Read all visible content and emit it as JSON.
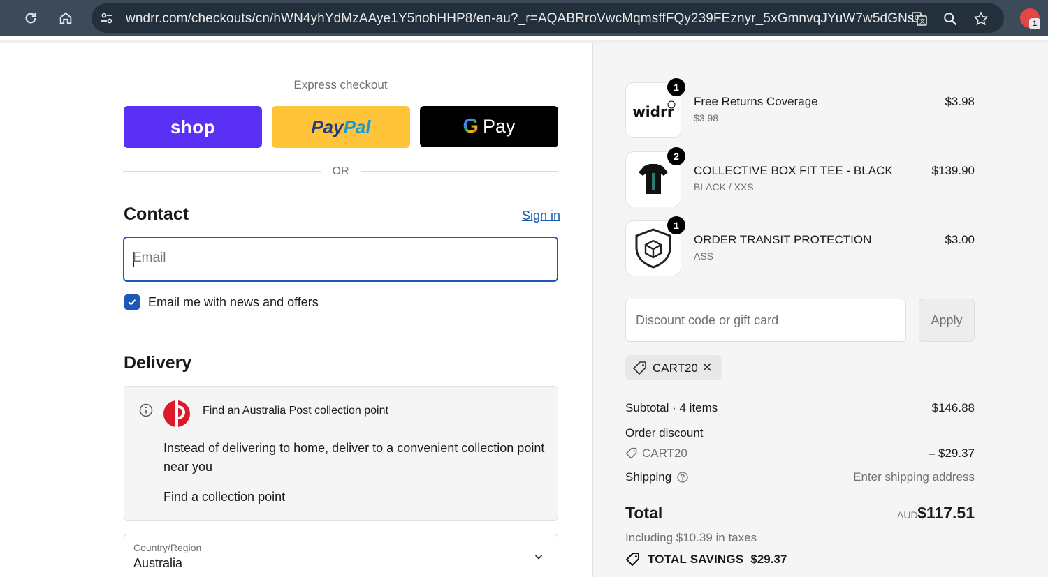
{
  "browser": {
    "url": "wndrr.com/checkouts/cn/hWN4yhYdMzAAye1Y5nohHHP8/en-au?_r=AQABRroVwcMqmsffFQy239FEznyr_5xGmnvqJYuW7w5dGNs",
    "profile_badge": "1"
  },
  "express": {
    "title": "Express checkout",
    "shop_label": "shop",
    "paypal_part1": "Pay",
    "paypal_part2": "Pal",
    "gpay_g": "G",
    "gpay_label": "Pay",
    "or_text": "OR"
  },
  "contact": {
    "title": "Contact",
    "sign_in": "Sign in",
    "email_placeholder": "Email",
    "news_label": "Email me with news and offers",
    "news_checked": true
  },
  "delivery": {
    "title": "Delivery",
    "collection_title": "Find an Australia Post collection point",
    "collection_desc": "Instead of delivering to home, deliver to a convenient collection point near you",
    "collection_link": "Find a collection point",
    "country_label": "Country/Region",
    "country_value": "Australia"
  },
  "summary": {
    "items": [
      {
        "name": "Free Returns Coverage",
        "sub": "$3.98",
        "price": "$3.98",
        "qty": "1",
        "thumb_text": "widrr"
      },
      {
        "name": "COLLECTIVE BOX FIT TEE - BLACK",
        "sub": "BLACK / XXS",
        "price": "$139.90",
        "qty": "2"
      },
      {
        "name": "ORDER TRANSIT PROTECTION",
        "sub": "ASS",
        "price": "$3.00",
        "qty": "1"
      }
    ],
    "discount_placeholder": "Discount code or gift card",
    "apply_label": "Apply",
    "applied_code": "CART20",
    "subtotal_label": "Subtotal · 4 items",
    "subtotal_value": "$146.88",
    "order_discount_label": "Order discount",
    "order_discount_code": "CART20",
    "order_discount_value": "– $29.37",
    "shipping_label": "Shipping",
    "shipping_value": "Enter shipping address",
    "total_label": "Total",
    "total_currency": "AUD",
    "total_value": "$117.51",
    "tax_line": "Including $10.39 in taxes",
    "savings_label": "TOTAL SAVINGS",
    "savings_value": "$29.37"
  },
  "colors": {
    "shop_purple": "#5a31f4",
    "paypal_yellow": "#ffc439",
    "link_blue": "#1a5fb4",
    "focus_blue": "#1f57b8",
    "auspost_red": "#dc1928"
  }
}
